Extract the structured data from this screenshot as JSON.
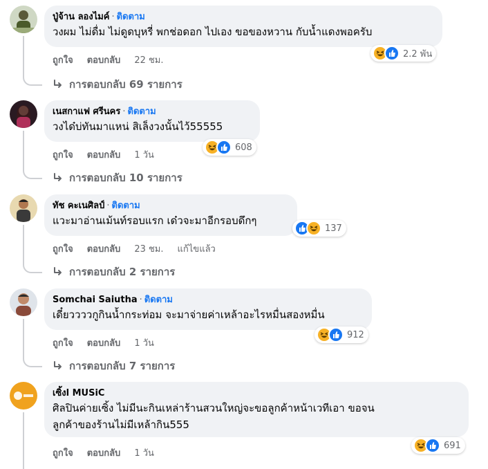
{
  "comments": [
    {
      "name": "ปู่จ้าน ลองไมค์",
      "follow": "ติดตาม",
      "text": [
        "วงผม ไม่ดื่ม ไม่ดูดบุหรี่ พกช่อดอก ไปเอง ขอของหวาน กับน้ำแดงพอครับ"
      ],
      "reactions": {
        "icons": [
          "haha",
          "like"
        ],
        "count": "2.2 พัน"
      },
      "like": "ถูกใจ",
      "reply": "ตอบกลับ",
      "time": "22 ชม.",
      "replies": "การตอบกลับ 69 รายการ"
    },
    {
      "name": "เนสกาแฟ ศรีนคร",
      "follow": "ติดตาม",
      "text": [
        "วงได๋บ่ทันมาแหน่ สิเล็งวงนั้นไว้55555"
      ],
      "reactions": {
        "icons": [
          "haha",
          "like"
        ],
        "count": "608"
      },
      "like": "ถูกใจ",
      "reply": "ตอบกลับ",
      "time": "1 วัน",
      "replies": "การตอบกลับ 10 รายการ"
    },
    {
      "name": "ทัช คะเนศิลป์",
      "follow": "ติดตาม",
      "text": [
        "แวะมาอ่านเม้นท์รอบแรก เด๋วจะมาอีกรอบดึกๆ"
      ],
      "reactions": {
        "icons": [
          "like",
          "haha"
        ],
        "count": "137"
      },
      "like": "ถูกใจ",
      "reply": "ตอบกลับ",
      "time": "23 ชม.",
      "edited": "แก้ไขแล้ว",
      "replies": "การตอบกลับ 2 รายการ"
    },
    {
      "name": "Somchai Saiutha",
      "follow": "ติดตาม",
      "text": [
        "เดี๋ยววววกูกินน้ำกระท่อม จะมาจ่ายค่าเหล้าอะไรหมื่นสองหมื่น"
      ],
      "reactions": {
        "icons": [
          "haha",
          "like"
        ],
        "count": "912"
      },
      "like": "ถูกใจ",
      "reply": "ตอบกลับ",
      "time": "1 วัน",
      "replies": "การตอบกลับ 7 รายการ"
    },
    {
      "name": "เซิ้งl MUSiC",
      "text": [
        "ศิลปินค่ายเซิ้ง ไม่มีนะกินเหล่าร้านสวนใหญ่จะขอลูกค้าหน้าเวทีเอา ขอจน",
        "ลูกค้าของร้านไม่มีเหล้ากิน555"
      ],
      "reactions": {
        "icons": [
          "haha",
          "like"
        ],
        "count": "691"
      },
      "like": "ถูกใจ",
      "reply": "ตอบกลับ",
      "time": "1 วัน"
    }
  ],
  "colors": {
    "bubble": "#f0f2f5",
    "link_blue": "#1877f2",
    "secondary_text": "#65676b",
    "haha_yellow": "#f7b125",
    "like_blue": "#1877f2"
  }
}
